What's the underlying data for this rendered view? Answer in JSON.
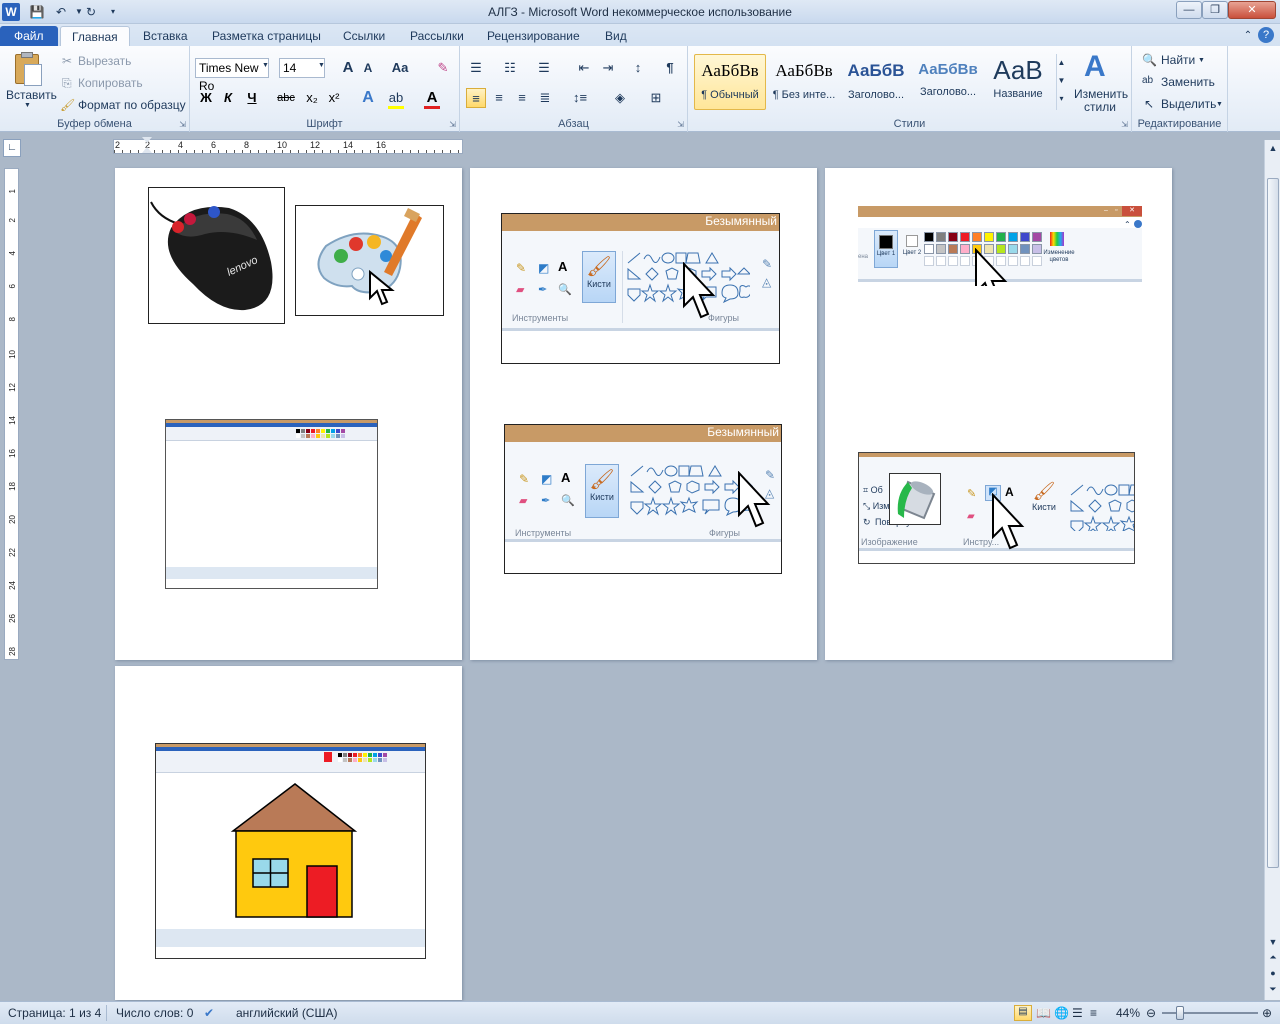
{
  "app": {
    "title": "АЛГЗ - Microsoft Word некоммерческое использование",
    "logo": "W"
  },
  "window_controls": {
    "minimize": "—",
    "restore": "❐",
    "close": "✕"
  },
  "tabs": [
    {
      "label": "Файл"
    },
    {
      "label": "Главная"
    },
    {
      "label": "Вставка"
    },
    {
      "label": "Разметка страницы"
    },
    {
      "label": "Ссылки"
    },
    {
      "label": "Рассылки"
    },
    {
      "label": "Рецензирование"
    },
    {
      "label": "Вид"
    }
  ],
  "ribbon": {
    "clipboard": {
      "label": "Буфер обмена",
      "paste": "Вставить",
      "cut": "Вырезать",
      "copy": "Копировать",
      "format_painter": "Формат по образцу"
    },
    "font": {
      "label": "Шрифт",
      "font_name": "Times New Ro",
      "font_size": "14",
      "grow": "A",
      "shrink": "A",
      "case": "Aa",
      "bold": "Ж",
      "italic": "К",
      "underline": "Ч",
      "strike": "abc",
      "subscript": "x₂",
      "superscript": "x²",
      "color_a": "A"
    },
    "paragraph": {
      "label": "Абзац",
      "pilcrow": "¶"
    },
    "styles": {
      "label": "Стили",
      "items": [
        {
          "preview": "АаБбВв",
          "name": "¶ Обычный"
        },
        {
          "preview": "АаБбВв",
          "name": "¶ Без инте..."
        },
        {
          "preview": "АаБбВ",
          "name": "Заголово..."
        },
        {
          "preview": "АаБбВв",
          "name": "Заголово..."
        },
        {
          "preview": "АаВ",
          "name": "Название"
        }
      ],
      "change": "Изменить стили"
    },
    "editing": {
      "label": "Редактирование",
      "find": "Найти",
      "replace": "Заменить",
      "select": "Выделить"
    }
  },
  "ruler": {
    "marks": [
      "2",
      "2",
      "4",
      "6",
      "8",
      "10",
      "12",
      "14",
      "16"
    ],
    "vmarks": [
      "1",
      "2",
      "4",
      "6",
      "8",
      "10",
      "12",
      "14",
      "16",
      "18",
      "20",
      "22",
      "24",
      "26",
      "28"
    ]
  },
  "pages": {
    "page1": {
      "mouse_brand": "lenovo"
    },
    "page2": {
      "paint_title": "Безымянный",
      "tools_label": "Инструменты",
      "brushes_label": "Кисти",
      "shapes_label": "Фигуры"
    },
    "page3": {
      "color1": "Цвет 1",
      "color2": "Цвет 2",
      "edit_colors": "Изменение цветов",
      "image_label": "Изображение",
      "rotate": "Повернуть",
      "tools_label": "Инстру...",
      "brushes_label": "Кисти",
      "edge_text": "ена"
    }
  },
  "colors": {
    "palette": [
      "#000000",
      "#7f7f7f",
      "#880015",
      "#ed1c24",
      "#ff7f27",
      "#fff200",
      "#22b14c",
      "#00a2e8",
      "#3f48cc",
      "#a349a4",
      "#ffffff",
      "#c3c3c3",
      "#b97a57",
      "#ffaec9",
      "#ffc90e",
      "#efe4b0",
      "#b5e61d",
      "#99d9ea",
      "#7092be",
      "#c8bfe7"
    ],
    "paint_title": "#c89a66",
    "house_roof": "#b97a57",
    "house_wall": "#ffc90e",
    "house_door": "#ed1c24",
    "house_window": "#99d9ea"
  },
  "status": {
    "page": "Страница: 1 из 4",
    "words": "Число слов: 0",
    "language": "английский (США)",
    "zoom": "44%"
  }
}
